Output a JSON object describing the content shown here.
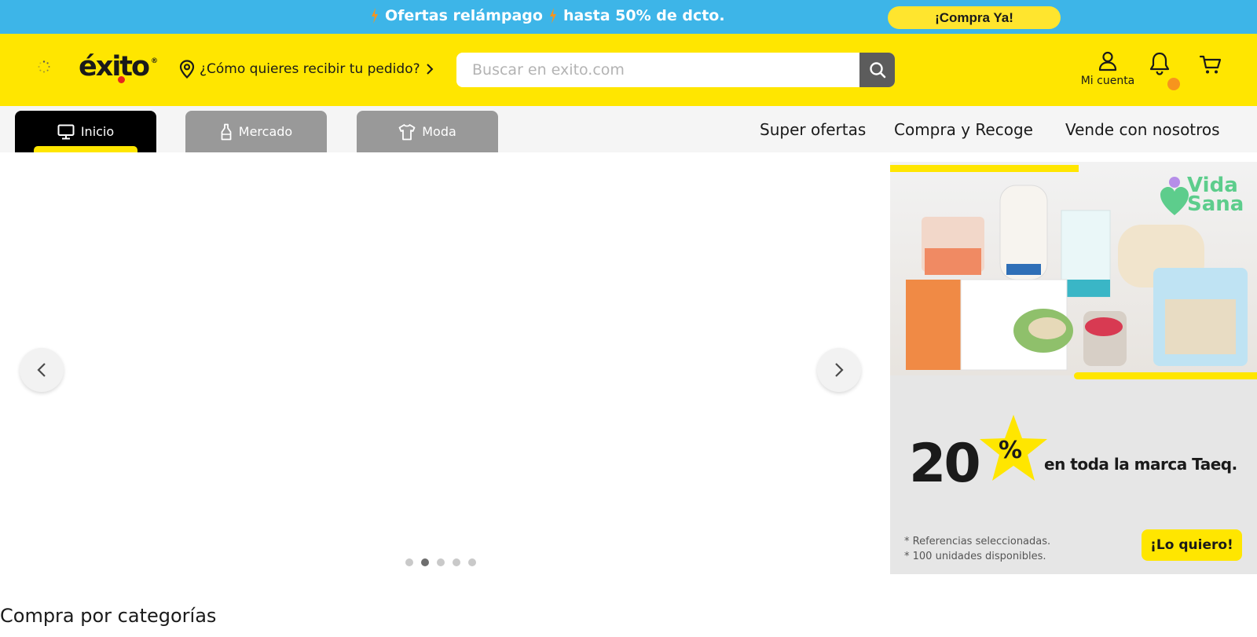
{
  "promo": {
    "text_1": "Ofertas relámpago",
    "text_2": "hasta 50% de dcto.",
    "cta": "¡Compra Ya!"
  },
  "header": {
    "logo": "éxito",
    "logo_mark": "®",
    "delivery_prompt": "¿Cómo quieres recibir tu pedido?",
    "search_placeholder": "Buscar en exito.com",
    "account_label": "Mi cuenta"
  },
  "nav": {
    "tabs": [
      {
        "label": "Inicio",
        "icon": "monitor-icon",
        "active": true
      },
      {
        "label": "Mercado",
        "icon": "bottle-icon",
        "active": false
      },
      {
        "label": "Moda",
        "icon": "shirt-icon",
        "active": false
      }
    ],
    "links": [
      "Super ofertas",
      "Compra y Recoge",
      "Vende con nosotros"
    ]
  },
  "carousel": {
    "slide_count": 5,
    "active_index": 1
  },
  "banner": {
    "brand_line_1": "Vida",
    "brand_line_2": "Sana",
    "discount_number": "20",
    "discount_sign": "%",
    "discount_text": "en toda la marca Taeq.",
    "note_1": "* Referencias seleccionadas.",
    "note_2": "* 100 unidades disponibles.",
    "cta": "¡Lo quiero!"
  },
  "sections": {
    "categories_title": "Compra por categorías"
  },
  "colors": {
    "promo_blue": "#3db5e8",
    "brand_yellow": "#ffe600",
    "bolt_orange": "#f7941d",
    "logo_red": "#e4261f",
    "vida_sana_green": "#5dcd8c"
  }
}
